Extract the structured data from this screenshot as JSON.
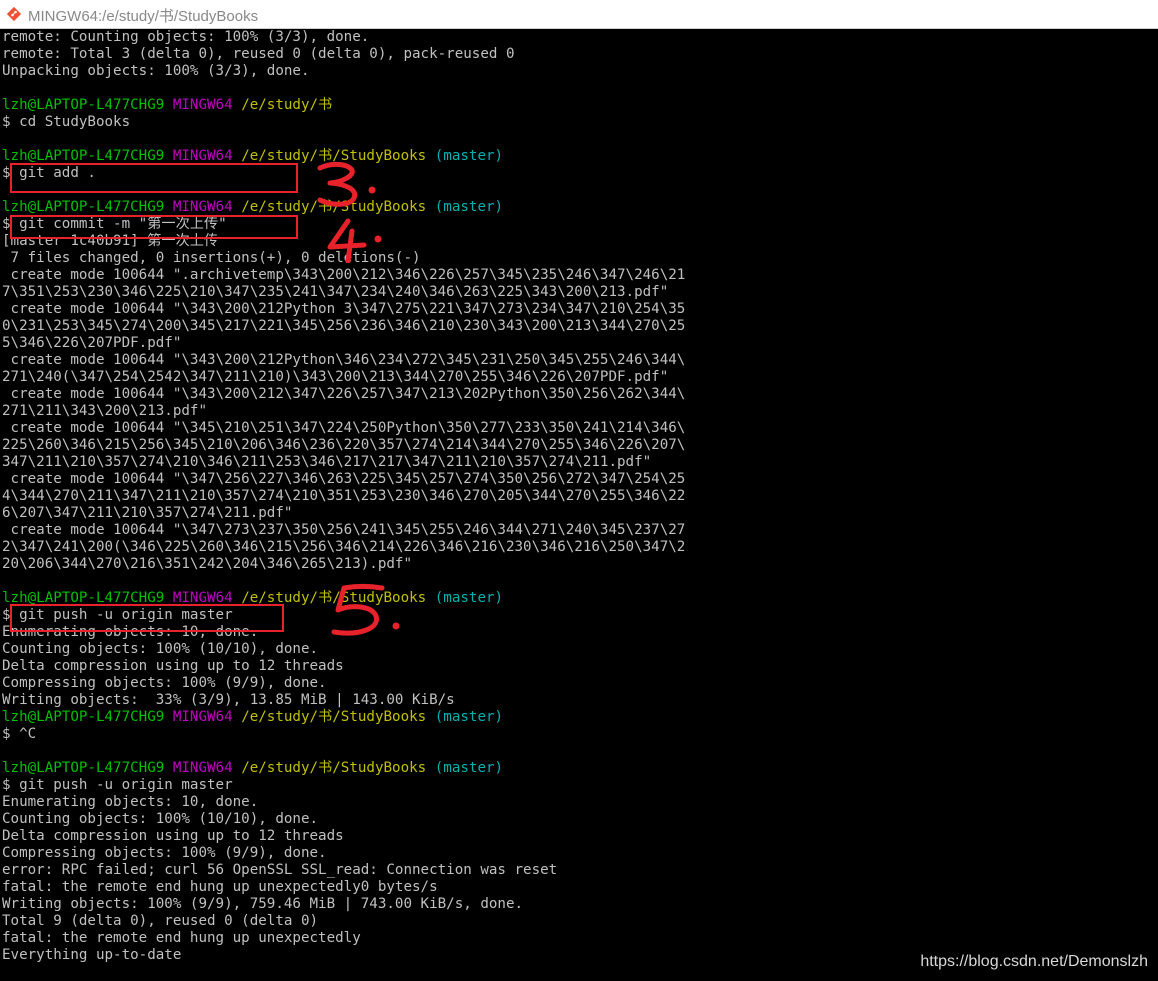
{
  "window": {
    "title": "MINGW64:/e/study/书/StudyBooks",
    "icon": "git-bash-icon"
  },
  "terminal": {
    "colors": {
      "text": "#c0c0c0",
      "user": "#00c000",
      "mingw": "#c000c0",
      "path": "#c0c000",
      "branch": "#00b0b0",
      "annotation": "#e8222a"
    },
    "lines": [
      {
        "type": "text",
        "text": "remote: Counting objects: 100% (3/3), done."
      },
      {
        "type": "text",
        "text": "remote: Total 3 (delta 0), reused 0 (delta 0), pack-reused 0"
      },
      {
        "type": "text",
        "text": "Unpacking objects: 100% (3/3), done."
      },
      {
        "type": "text",
        "text": ""
      },
      {
        "type": "prompt",
        "user": "lzh@LAPTOP-L477CHG9",
        "env": "MINGW64",
        "path": "/e/study/书",
        "branch": ""
      },
      {
        "type": "text",
        "text": "$ cd StudyBooks"
      },
      {
        "type": "text",
        "text": ""
      },
      {
        "type": "prompt",
        "user": "lzh@LAPTOP-L477CHG9",
        "env": "MINGW64",
        "path": "/e/study/书/StudyBooks",
        "branch": "(master)"
      },
      {
        "type": "text",
        "text": "$ git add ."
      },
      {
        "type": "text",
        "text": ""
      },
      {
        "type": "prompt",
        "user": "lzh@LAPTOP-L477CHG9",
        "env": "MINGW64",
        "path": "/e/study/书/StudyBooks",
        "branch": "(master)"
      },
      {
        "type": "text",
        "text": "$ git commit -m \"第一次上传\""
      },
      {
        "type": "text",
        "text": "[master 1c40b91] 第一次上传"
      },
      {
        "type": "text",
        "text": " 7 files changed, 0 insertions(+), 0 deletions(-)"
      },
      {
        "type": "text",
        "text": " create mode 100644 \".archivetemp\\343\\200\\212\\346\\226\\257\\345\\235\\246\\347\\246\\21"
      },
      {
        "type": "text",
        "text": "7\\351\\253\\230\\346\\225\\210\\347\\235\\241\\347\\234\\240\\346\\263\\225\\343\\200\\213.pdf\""
      },
      {
        "type": "text",
        "text": " create mode 100644 \"\\343\\200\\212Python 3\\347\\275\\221\\347\\273\\234\\347\\210\\254\\35"
      },
      {
        "type": "text",
        "text": "0\\231\\253\\345\\274\\200\\345\\217\\221\\345\\256\\236\\346\\210\\230\\343\\200\\213\\344\\270\\25"
      },
      {
        "type": "text",
        "text": "5\\346\\226\\207PDF.pdf\""
      },
      {
        "type": "text",
        "text": " create mode 100644 \"\\343\\200\\212Python\\346\\234\\272\\345\\231\\250\\345\\255\\246\\344\\"
      },
      {
        "type": "text",
        "text": "271\\240(\\347\\254\\2542\\347\\211\\210)\\343\\200\\213\\344\\270\\255\\346\\226\\207PDF.pdf\""
      },
      {
        "type": "text",
        "text": " create mode 100644 \"\\343\\200\\212\\347\\226\\257\\347\\213\\202Python\\350\\256\\262\\344\\"
      },
      {
        "type": "text",
        "text": "271\\211\\343\\200\\213.pdf\""
      },
      {
        "type": "text",
        "text": " create mode 100644 \"\\345\\210\\251\\347\\224\\250Python\\350\\277\\233\\350\\241\\214\\346\\"
      },
      {
        "type": "text",
        "text": "225\\260\\346\\215\\256\\345\\210\\206\\346\\236\\220\\357\\274\\214\\344\\270\\255\\346\\226\\207\\"
      },
      {
        "type": "text",
        "text": "347\\211\\210\\357\\274\\210\\346\\211\\253\\346\\217\\217\\347\\211\\210\\357\\274\\211.pdf\""
      },
      {
        "type": "text",
        "text": " create mode 100644 \"\\347\\256\\227\\346\\263\\225\\345\\257\\274\\350\\256\\272\\347\\254\\25"
      },
      {
        "type": "text",
        "text": "4\\344\\270\\211\\347\\211\\210\\357\\274\\210\\351\\253\\230\\346\\270\\205\\344\\270\\255\\346\\22"
      },
      {
        "type": "text",
        "text": "6\\207\\347\\211\\210\\357\\274\\211.pdf\""
      },
      {
        "type": "text",
        "text": " create mode 100644 \"\\347\\273\\237\\350\\256\\241\\345\\255\\246\\344\\271\\240\\345\\237\\27"
      },
      {
        "type": "text",
        "text": "2\\347\\241\\200(\\346\\225\\260\\346\\215\\256\\346\\214\\226\\346\\216\\230\\346\\216\\250\\347\\2"
      },
      {
        "type": "text",
        "text": "20\\206\\344\\270\\216\\351\\242\\204\\346\\265\\213).pdf\""
      },
      {
        "type": "text",
        "text": ""
      },
      {
        "type": "prompt",
        "user": "lzh@LAPTOP-L477CHG9",
        "env": "MINGW64",
        "path": "/e/study/书/StudyBooks",
        "branch": "(master)"
      },
      {
        "type": "text",
        "text": "$ git push -u origin master"
      },
      {
        "type": "text",
        "text": "Enumerating objects: 10, done."
      },
      {
        "type": "text",
        "text": "Counting objects: 100% (10/10), done."
      },
      {
        "type": "text",
        "text": "Delta compression using up to 12 threads"
      },
      {
        "type": "text",
        "text": "Compressing objects: 100% (9/9), done."
      },
      {
        "type": "text",
        "text": "Writing objects:  33% (3/9), 13.85 MiB | 143.00 KiB/s"
      },
      {
        "type": "prompt",
        "user": "lzh@LAPTOP-L477CHG9",
        "env": "MINGW64",
        "path": "/e/study/书/StudyBooks",
        "branch": "(master)"
      },
      {
        "type": "text",
        "text": "$ ^C"
      },
      {
        "type": "text",
        "text": ""
      },
      {
        "type": "prompt",
        "user": "lzh@LAPTOP-L477CHG9",
        "env": "MINGW64",
        "path": "/e/study/书/StudyBooks",
        "branch": "(master)"
      },
      {
        "type": "text",
        "text": "$ git push -u origin master"
      },
      {
        "type": "text",
        "text": "Enumerating objects: 10, done."
      },
      {
        "type": "text",
        "text": "Counting objects: 100% (10/10), done."
      },
      {
        "type": "text",
        "text": "Delta compression using up to 12 threads"
      },
      {
        "type": "text",
        "text": "Compressing objects: 100% (9/9), done."
      },
      {
        "type": "text",
        "text": "error: RPC failed; curl 56 OpenSSL SSL_read: Connection was reset"
      },
      {
        "type": "text",
        "text": "fatal: the remote end hung up unexpectedly0 bytes/s"
      },
      {
        "type": "text",
        "text": "Writing objects: 100% (9/9), 759.46 MiB | 743.00 KiB/s, done."
      },
      {
        "type": "text",
        "text": "Total 9 (delta 0), reused 0 (delta 0)"
      },
      {
        "type": "text",
        "text": "fatal: the remote end hung up unexpectedly"
      },
      {
        "type": "text",
        "text": "Everything up-to-date"
      }
    ]
  },
  "annotations": [
    {
      "name": "step-3",
      "label": "3."
    },
    {
      "name": "step-4",
      "label": "4."
    },
    {
      "name": "step-5",
      "label": "5."
    }
  ],
  "watermark": "https://blog.csdn.net/Demonslzh"
}
